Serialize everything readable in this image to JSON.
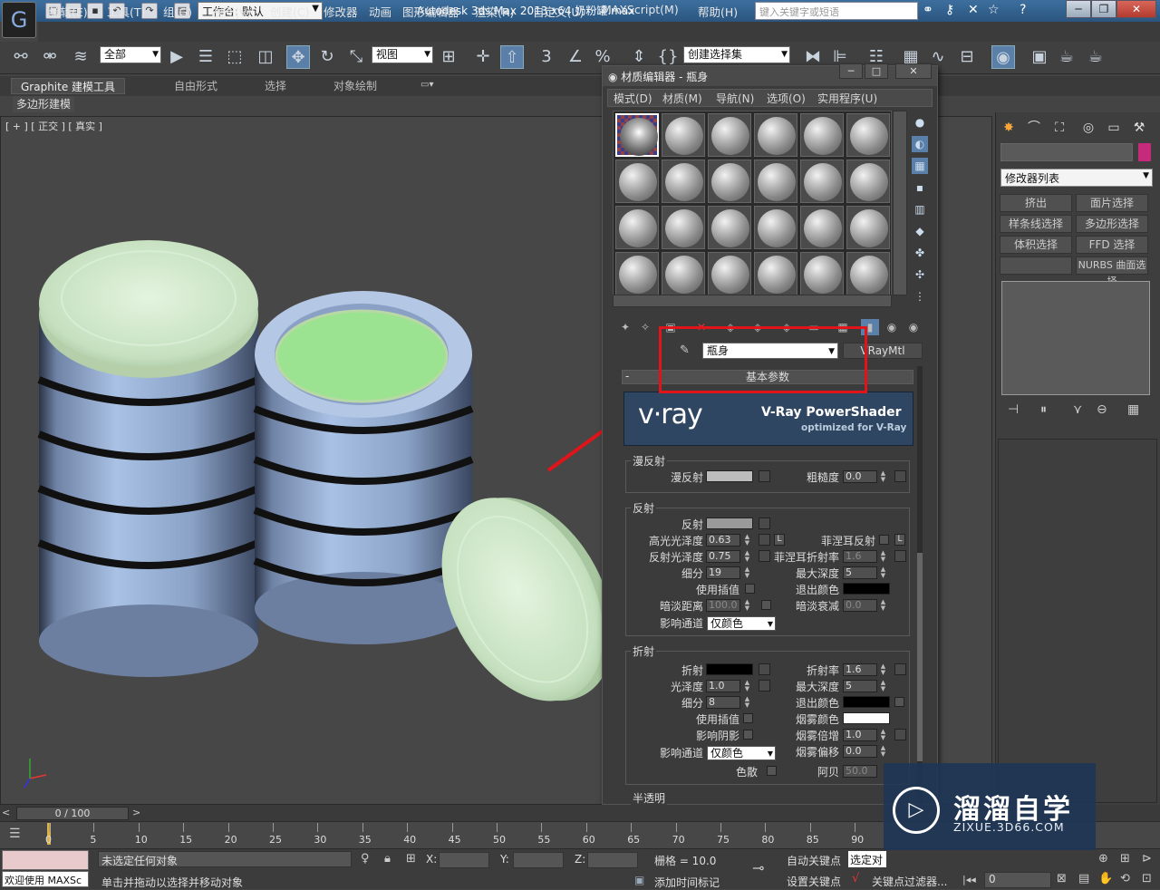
{
  "titlebar": {
    "workspace": "工作台: 默认",
    "app_title": "Autodesk 3ds Max  2013 x64      奶粉罐.max",
    "search_placeholder": "键入关键字或短语"
  },
  "menubar": [
    "编辑(E)",
    "工具(T)",
    "组(G)",
    "视图(V)",
    "创建(C)",
    "修改器",
    "动画",
    "图形编辑器",
    "渲染(R)",
    "自定义(U)",
    "MAXScript(M)",
    "帮助(H)"
  ],
  "toolbar": {
    "filter": "全部",
    "refcoord": "视图",
    "named_sel": "创建选择集",
    "snap_num": "3",
    "percent": "%"
  },
  "ribbon": {
    "tabs": [
      "Graphite 建模工具",
      "自由形式",
      "选择",
      "对象绘制"
    ],
    "subtab": "多边形建模"
  },
  "viewport": {
    "label": "[ + ] [ 正交 ] [ 真实 ]"
  },
  "material_editor": {
    "title": "材质编辑器 - 瓶身",
    "menus": [
      "模式(D)",
      "材质(M)",
      "导航(N)",
      "选项(O)",
      "实用程序(U)"
    ],
    "material_name": "瓶身",
    "material_type": "VRayMtl",
    "rollout": "基本参数",
    "vray_logo": "v·ray",
    "vray_title": "V-Ray PowerShader",
    "vray_sub": "optimized for V-Ray",
    "diffuse": {
      "group": "漫反射",
      "diffuse_label": "漫反射",
      "roughness_label": "粗糙度",
      "roughness": "0.0",
      "diffuse_color": "#bcbcbc"
    },
    "reflection": {
      "group": "反射",
      "reflect_label": "反射",
      "reflect_color": "#9a9a9a",
      "hilight_label": "高光光泽度",
      "hilight": "0.63",
      "refl_gloss_label": "反射光泽度",
      "refl_gloss": "0.75",
      "subdivs_label": "细分",
      "subdivs": "19",
      "interp_label": "使用插值",
      "dim_dist_label": "暗淡距离",
      "dim_dist": "100.0",
      "affect_label": "影响通道",
      "affect": "仅颜色",
      "fresnel_label": "菲涅耳反射",
      "fresnel_ior_label": "菲涅耳折射率",
      "fresnel_ior": "1.6",
      "max_depth_label": "最大深度",
      "max_depth": "5",
      "exit_color_label": "退出颜色",
      "dim_falloff_label": "暗淡衰减",
      "dim_falloff": "0.0",
      "l_button": "L"
    },
    "refraction": {
      "group": "折射",
      "refract_label": "折射",
      "gloss_label": "光泽度",
      "gloss": "1.0",
      "subdivs_label": "细分",
      "subdivs": "8",
      "interp_label": "使用插值",
      "shadow_label": "影响阴影",
      "affect_label": "影响通道",
      "affect": "仅颜色",
      "dispersion_label": "色散",
      "ior_label": "折射率",
      "ior": "1.6",
      "max_depth_label": "最大深度",
      "max_depth": "5",
      "exit_color_label": "退出颜色",
      "fog_color_label": "烟雾颜色",
      "fog_mult_label": "烟雾倍增",
      "fog_mult": "1.0",
      "fog_bias_label": "烟雾偏移",
      "fog_bias": "0.0",
      "abbe_label": "阿贝",
      "abbe": "50.0"
    },
    "translucency_group": "半透明"
  },
  "cmd_panel": {
    "modifier_list": "修改器列表",
    "buttons": [
      "挤出",
      "面片选择",
      "样条线选择",
      "多边形选择",
      "体积选择",
      "FFD 选择",
      "",
      "NURBS 曲面选择"
    ]
  },
  "timeline": {
    "frame_display": "0 / 100",
    "ticks": [
      "0",
      "5",
      "10",
      "15",
      "20",
      "25",
      "30",
      "35",
      "40",
      "45",
      "50",
      "55",
      "60",
      "65",
      "70",
      "75",
      "80",
      "85",
      "90"
    ]
  },
  "status": {
    "welcome": "欢迎使用 MAXSc",
    "selection": "未选定任何对象",
    "prompt": "单击并拖动以选择并移动对象",
    "x": "X:",
    "y": "Y:",
    "z": "Z:",
    "grid": "栅格 = 10.0",
    "auto_key": "自动关键点",
    "set_key": "设置关键点",
    "selected": "选定对",
    "key_filter": "关键点过滤器...",
    "add_time_tag": "添加时间标记",
    "frame": "0"
  },
  "watermark": {
    "main": "溜溜自学",
    "sub": "ZIXUE.3D66.COM"
  }
}
